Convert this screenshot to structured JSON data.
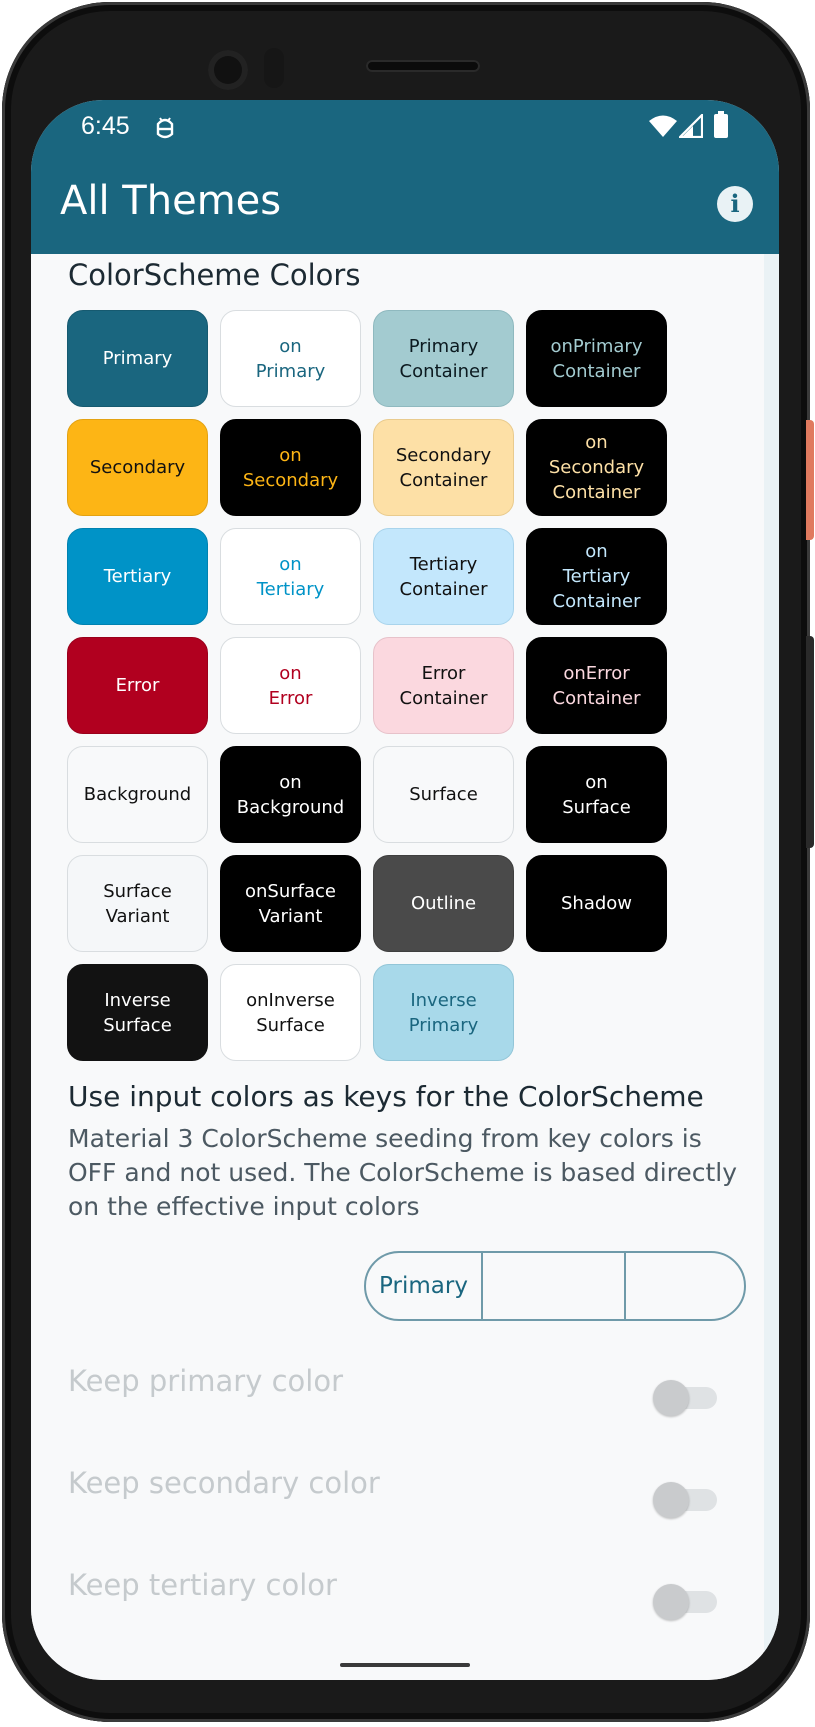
{
  "status_bar": {
    "time": "6:45"
  },
  "app_bar": {
    "title": "All Themes"
  },
  "colors": {
    "primary": "#1a667f",
    "background": "#f8f9fa"
  },
  "colorscheme": {
    "title": "ColorScheme Colors",
    "chips": [
      {
        "label": "Primary",
        "bg": "#1a667f",
        "fg": "#ffffff",
        "border": "#165a70"
      },
      {
        "label": "on\nPrimary",
        "bg": "#ffffff",
        "fg": "#1a667f",
        "border": "#d9dde0"
      },
      {
        "label": "Primary\nContainer",
        "bg": "#a3cbd0",
        "fg": "#0c1a20",
        "border": "#8fb9bf"
      },
      {
        "label": "onPrimary\nContainer",
        "bg": "#000000",
        "fg": "#a3cbd0",
        "border": "#000000"
      },
      {
        "label": "Secondary",
        "bg": "#fdb515",
        "fg": "#111111",
        "border": "#e3a212"
      },
      {
        "label": "on\nSecondary",
        "bg": "#000000",
        "fg": "#fdb515",
        "border": "#000000"
      },
      {
        "label": "Secondary\nContainer",
        "bg": "#fde0a6",
        "fg": "#111111",
        "border": "#e9cb8e"
      },
      {
        "label": "on\nSecondary\nContainer",
        "bg": "#000000",
        "fg": "#fde0a6",
        "border": "#000000"
      },
      {
        "label": "Tertiary",
        "bg": "#0093c7",
        "fg": "#ffffff",
        "border": "#0082b0"
      },
      {
        "label": "on\nTertiary",
        "bg": "#ffffff",
        "fg": "#0093c7",
        "border": "#d9dde0"
      },
      {
        "label": "Tertiary\nContainer",
        "bg": "#c3e7fc",
        "fg": "#111111",
        "border": "#a9d4ec"
      },
      {
        "label": "on\nTertiary\nContainer",
        "bg": "#000000",
        "fg": "#c3e7fc",
        "border": "#000000"
      },
      {
        "label": "Error",
        "bg": "#b1001f",
        "fg": "#ffffff",
        "border": "#9a001b"
      },
      {
        "label": "on\nError",
        "bg": "#ffffff",
        "fg": "#b1001f",
        "border": "#d9dde0"
      },
      {
        "label": "Error\nContainer",
        "bg": "#fbd8df",
        "fg": "#111111",
        "border": "#e7c2ca"
      },
      {
        "label": "onError\nContainer",
        "bg": "#000000",
        "fg": "#fbd8df",
        "border": "#000000"
      },
      {
        "label": "Background",
        "bg": "#f8f9fa",
        "fg": "#111111",
        "border": "#d9dde0"
      },
      {
        "label": "on\nBackground",
        "bg": "#000000",
        "fg": "#ffffff",
        "border": "#000000"
      },
      {
        "label": "Surface",
        "bg": "#f8f9fa",
        "fg": "#111111",
        "border": "#d9dde0"
      },
      {
        "label": "on\nSurface",
        "bg": "#000000",
        "fg": "#ffffff",
        "border": "#000000"
      },
      {
        "label": "Surface\nVariant",
        "bg": "#f5f7f9",
        "fg": "#111111",
        "border": "#d9dde0"
      },
      {
        "label": "onSurface\nVariant",
        "bg": "#000000",
        "fg": "#ffffff",
        "border": "#000000"
      },
      {
        "label": "Outline",
        "bg": "#4a4a4a",
        "fg": "#ffffff",
        "border": "#3f3f3f"
      },
      {
        "label": "Shadow",
        "bg": "#000000",
        "fg": "#ffffff",
        "border": "#000000"
      },
      {
        "label": "Inverse\nSurface",
        "bg": "#121212",
        "fg": "#ffffff",
        "border": "#121212"
      },
      {
        "label": "onInverse\nSurface",
        "bg": "#ffffff",
        "fg": "#111111",
        "border": "#d9dde0"
      },
      {
        "label": "Inverse\nPrimary",
        "bg": "#a8d9ea",
        "fg": "#1a667f",
        "border": "#93c6d8"
      }
    ]
  },
  "seeding": {
    "heading": "Use input colors as keys for the ColorScheme",
    "description": "Material 3 ColorScheme seeding from key colors is OFF and not used. The ColorScheme is based directly on the effective input colors",
    "segments": [
      "Primary",
      "",
      ""
    ],
    "toggles": [
      {
        "label": "Keep primary color",
        "on": false
      },
      {
        "label": "Keep secondary color",
        "on": false
      },
      {
        "label": "Keep tertiary color",
        "on": false
      }
    ]
  }
}
